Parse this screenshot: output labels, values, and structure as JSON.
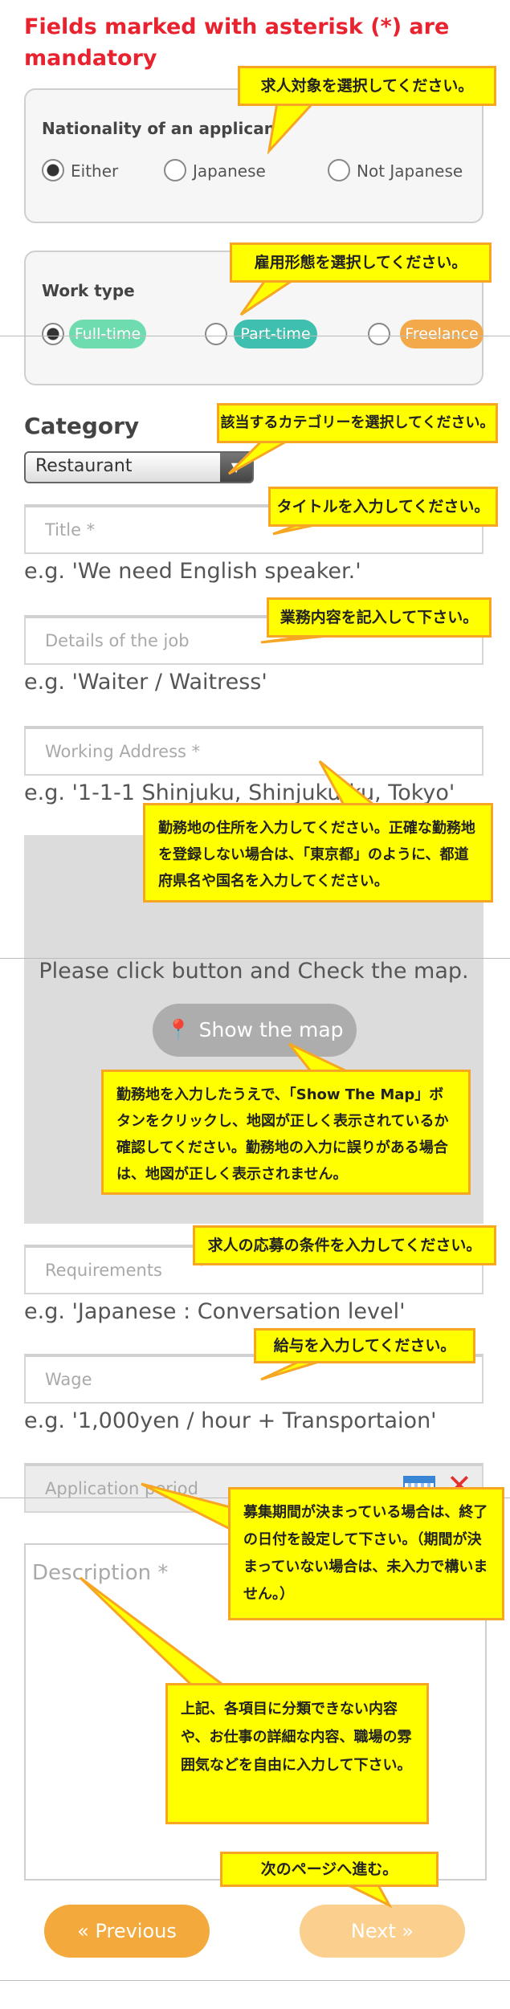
{
  "header": {
    "mandatory_notice": "Fields marked with asterisk (*) are mandatory"
  },
  "nationality": {
    "title": "Nationality of an applicant",
    "options": [
      "Either",
      "Japanese",
      "Not Japanese"
    ],
    "selected": "Either",
    "tip": "求人対象を選択してください。"
  },
  "work_type": {
    "title": "Work type",
    "options": [
      "Full-time",
      "Part-time",
      "Freelance"
    ],
    "selected": "Full-time",
    "tip": "雇用形態を選択してください。",
    "colors": {
      "full_time": "#6fdcb0",
      "part_time": "#3fbfae",
      "freelance": "#f3a84a"
    }
  },
  "category": {
    "label": "Category",
    "selected": "Restaurant",
    "tip": "該当するカテゴリーを選択してください。"
  },
  "title_field": {
    "placeholder": "Title *",
    "example": "e.g. 'We need English speaker.'",
    "tip": "タイトルを入力してください。"
  },
  "details_field": {
    "placeholder": "Details of the job",
    "example": "e.g. 'Waiter / Waitress'",
    "tip": "業務内容を記入して下さい。"
  },
  "address_field": {
    "placeholder": "Working Address *",
    "example": "e.g. '1-1-1 Shinjuku, Shinjuku-ku, Tokyo'",
    "tip": "勤務地の住所を入力してください。正確な勤務地を登録しない場合は、「東京都」のように、都道府県名や国名を入力してください。"
  },
  "map": {
    "prompt": "Please click button and Check the map.",
    "button_label": "Show the map",
    "tip": "勤務地を入力したうえで、「Show The Map」ボタンをクリックし、地図が正しく表示されているか確認してください。勤務地の入力に誤りがある場合は、地図が正しく表示されません。"
  },
  "requirements_field": {
    "placeholder": "Requirements",
    "example": "e.g. 'Japanese : Conversation level'",
    "tip": "求人の応募の条件を入力してください。"
  },
  "wage_field": {
    "placeholder": "Wage",
    "example": "e.g. '1,000yen / hour + Transportaion'",
    "tip": "給与を入力してください。"
  },
  "period_field": {
    "placeholder": "Application period",
    "tip": "募集期間が決まっている場合は、終了の日付を設定して下さい。（期間が決まっていない場合は、未入力で構いません。）"
  },
  "description_field": {
    "placeholder": "Description *",
    "tip": "上記、各項目に分類できない内容や、お仕事の詳細な内容、職場の雰囲気などを自由に入力して下さい。"
  },
  "nav": {
    "previous_label": "« Previous",
    "next_label": "Next »",
    "tip": "次のページへ進む。",
    "colors": {
      "previous": "#f3a93c",
      "next": "#fbd08e"
    }
  }
}
